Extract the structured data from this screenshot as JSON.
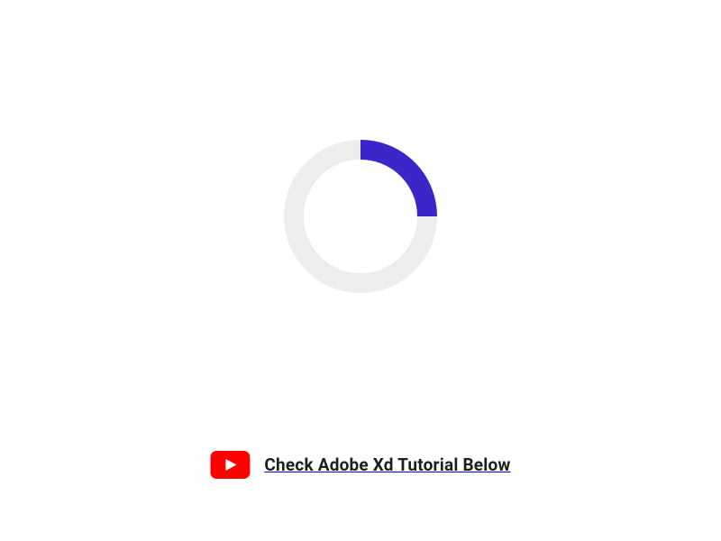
{
  "spinner": {
    "track_color": "#ededed",
    "arc_color": "#3a26c9",
    "percent": 25,
    "start_angle_deg": 0,
    "size": 170,
    "stroke": 22
  },
  "cta": {
    "label": "Check Adobe Xd Tutorial Below",
    "icon_bg": "#ff0000",
    "icon_fg": "#ffffff"
  }
}
